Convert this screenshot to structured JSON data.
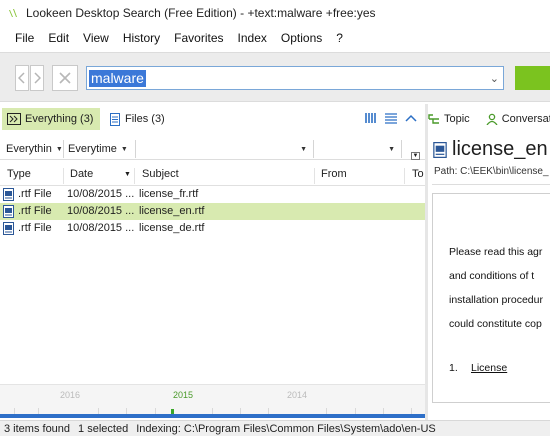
{
  "window": {
    "title": "Lookeen Desktop Search (Free Edition) - +text:malware +free:yes"
  },
  "menu": [
    "File",
    "Edit",
    "View",
    "History",
    "Favorites",
    "Index",
    "Options",
    "?"
  ],
  "search": {
    "query": "malware"
  },
  "tabs": {
    "everything": "Everything (3)",
    "files": "Files (3)"
  },
  "right_tabs": {
    "topic": "Topic",
    "conversation": "Conversatio"
  },
  "filters": {
    "scope": "Everythin",
    "date": "Everytime"
  },
  "columns": [
    "Type",
    "Date",
    "Subject",
    "From",
    "To"
  ],
  "rows": [
    {
      "type": ".rtf File",
      "date": "10/08/2015 ...",
      "subject": "license_fr.rtf",
      "selected": false
    },
    {
      "type": ".rtf File",
      "date": "10/08/2015 ...",
      "subject": "license_en.rtf",
      "selected": true
    },
    {
      "type": ".rtf File",
      "date": "10/08/2015 ...",
      "subject": "license_de.rtf",
      "selected": false
    }
  ],
  "timeline": {
    "years": [
      "2016",
      "2015",
      "2014"
    ],
    "current": "2015"
  },
  "preview": {
    "title": "license_en",
    "path": "Path: C:\\EEK\\bin\\license_",
    "lines": [
      "Please read this agr",
      "and conditions of t",
      "installation procedur",
      "could constitute cop"
    ],
    "list_num": "1.",
    "list_label": "License"
  },
  "status": {
    "found": "3 items found",
    "selected": "1 selected",
    "indexing": "Indexing: C:\\Program Files\\Common Files\\System\\ado\\en-US"
  },
  "colors": {
    "accent_green": "#7bc31f",
    "selection": "#d8eab0",
    "link_blue": "#2c6fc5"
  }
}
